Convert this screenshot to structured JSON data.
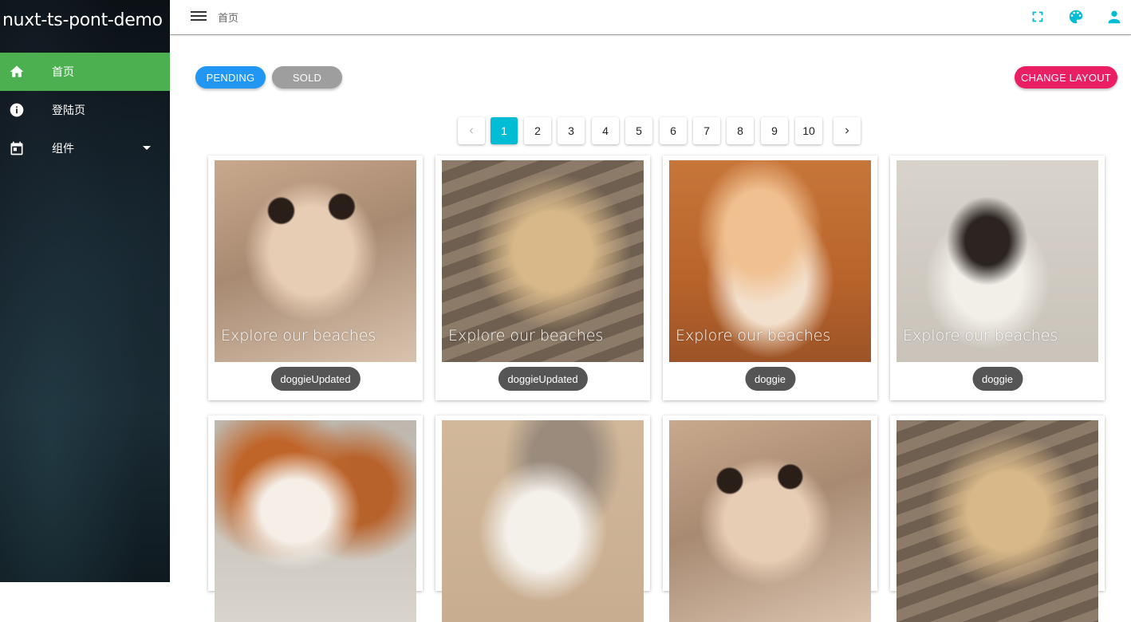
{
  "app": {
    "title": "nuxt-ts-pont-demo"
  },
  "sidebar": {
    "items": [
      {
        "label": "首页",
        "icon": "home-icon",
        "active": true
      },
      {
        "label": "登陆页",
        "icon": "info-icon",
        "active": false
      },
      {
        "label": "组件",
        "icon": "calendar-icon",
        "active": false,
        "expandable": true
      }
    ]
  },
  "topbar": {
    "breadcrumb": "首页",
    "icons": [
      "fullscreen-icon",
      "palette-icon",
      "account-icon"
    ]
  },
  "toolbar": {
    "pending_label": "PENDING",
    "sold_label": "SOLD",
    "change_layout_label": "CHANGE LAYOUT"
  },
  "pagination": {
    "pages": [
      "1",
      "2",
      "3",
      "4",
      "5",
      "6",
      "7",
      "8",
      "9",
      "10"
    ],
    "current": "1"
  },
  "cards": [
    {
      "caption": "Explore our beaches",
      "tag": "doggieUpdated"
    },
    {
      "caption": "Explore our beaches",
      "tag": "doggieUpdated"
    },
    {
      "caption": "Explore our beaches",
      "tag": "doggie"
    },
    {
      "caption": "Explore our beaches",
      "tag": "doggie"
    },
    {
      "caption": "",
      "tag": ""
    },
    {
      "caption": "",
      "tag": ""
    },
    {
      "caption": "",
      "tag": ""
    },
    {
      "caption": "",
      "tag": ""
    }
  ],
  "colors": {
    "sidebar_active": "#4caf50",
    "pending": "#2196f3",
    "sold": "#9e9e9e",
    "change_layout": "#e91e63",
    "page_current": "#00bcd4",
    "topbar_icons": "#00bcd4"
  }
}
